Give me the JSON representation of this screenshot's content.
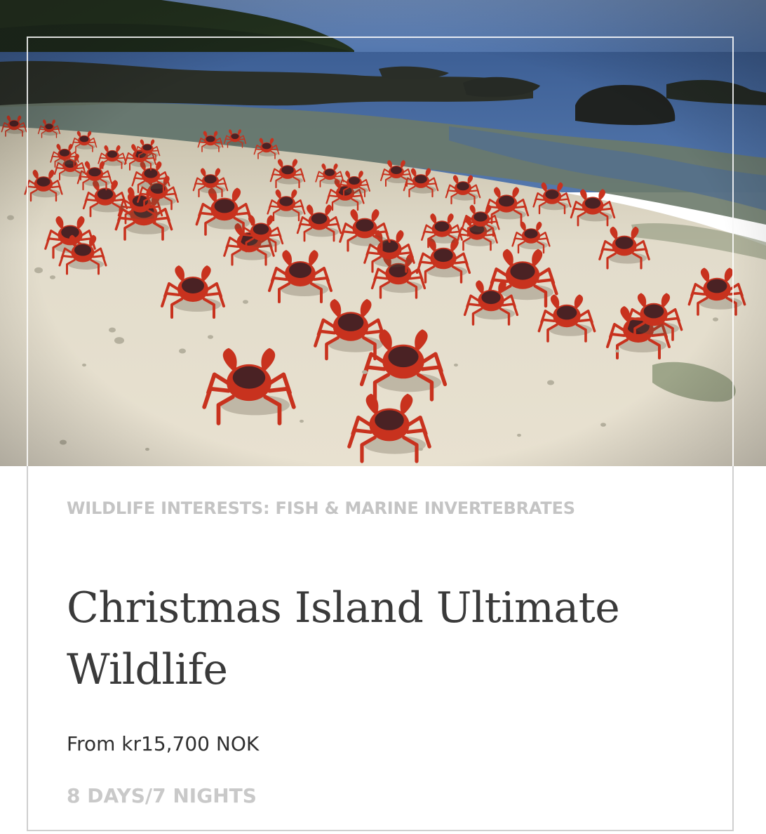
{
  "card": {
    "image_alt": "Red crabs on a sandy beach by the sea",
    "category": "WILDLIFE INTERESTS: FISH & MARINE INVERTEBRATES",
    "title": "Christmas Island Ultimate Wildlife",
    "price": "From kr15,700 NOK",
    "duration": "8 DAYS/7 NIGHTS"
  },
  "colors": {
    "title": "#3a3a3a",
    "category": "#c4c4c4",
    "duration": "#c9c9c9",
    "crab": "#c8321e",
    "sand": "#e3dccb",
    "sea": "#3c5f8e"
  }
}
